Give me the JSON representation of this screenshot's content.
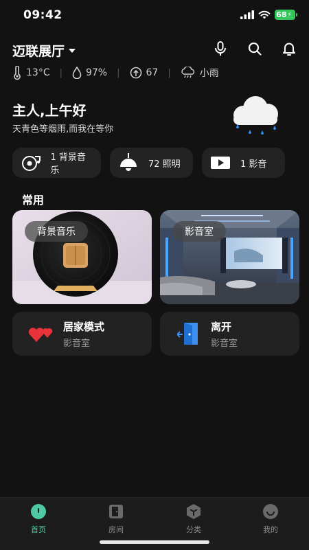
{
  "status_bar": {
    "time": "09:42",
    "battery": "68"
  },
  "header": {
    "home_name": "迈联展厅"
  },
  "weather": {
    "temperature": "13°C",
    "humidity": "97%",
    "air_quality": "67",
    "condition": "小雨"
  },
  "greeting": {
    "title": "主人,上午好",
    "subtitle": "天青色等烟雨,而我在等你"
  },
  "chips": [
    {
      "label": "1 背景音乐",
      "icon": "music-disc-icon"
    },
    {
      "label": "72 照明",
      "icon": "pendant-lamp-icon"
    },
    {
      "label": "1 影音",
      "icon": "tv-play-icon"
    }
  ],
  "section_title": "常用",
  "cards": [
    {
      "label": "背景音乐",
      "image": "vinyl-record-photo"
    },
    {
      "label": "影音室",
      "image": "home-theater-photo"
    }
  ],
  "modes": [
    {
      "title": "居家模式",
      "subtitle": "影音室",
      "icon": "hearts-icon"
    },
    {
      "title": "离开",
      "subtitle": "影音室",
      "icon": "door-exit-icon"
    }
  ],
  "nav": [
    {
      "label": "首页",
      "active": true
    },
    {
      "label": "房间",
      "active": false
    },
    {
      "label": "分类",
      "active": false
    },
    {
      "label": "我的",
      "active": false
    }
  ],
  "colors": {
    "accent": "#4fc9a4",
    "background": "#121212",
    "card": "#232323",
    "heart": "#e8333a",
    "door": "#3d8ff0"
  }
}
